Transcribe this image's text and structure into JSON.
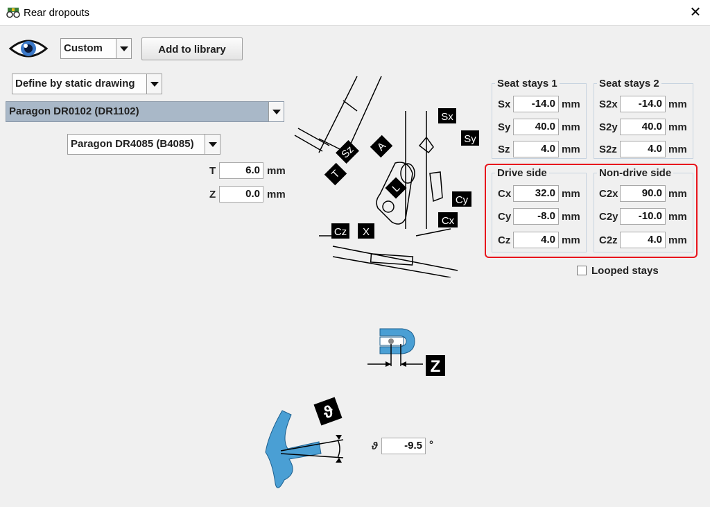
{
  "window": {
    "title": "Rear dropouts",
    "close_glyph": "✕"
  },
  "toolbar": {
    "preset_value": "Custom",
    "add_library_label": "Add to library",
    "define_mode_value": "Define by static drawing"
  },
  "dropout_select": {
    "value": "Paragon DR0102 (DR1102)"
  },
  "insert_select": {
    "value": "Paragon DR4085 (B4085)"
  },
  "thickness": {
    "T_label": "T",
    "T_value": "6.0",
    "Z_label": "Z",
    "Z_value": "0.0",
    "unit": "mm"
  },
  "seat_stays_1": {
    "title": "Seat stays 1",
    "rows": [
      {
        "label": "Sx",
        "value": "-14.0",
        "unit": "mm"
      },
      {
        "label": "Sy",
        "value": "40.0",
        "unit": "mm"
      },
      {
        "label": "Sz",
        "value": "4.0",
        "unit": "mm"
      }
    ]
  },
  "seat_stays_2": {
    "title": "Seat stays 2",
    "rows": [
      {
        "label": "S2x",
        "value": "-14.0",
        "unit": "mm"
      },
      {
        "label": "S2y",
        "value": "40.0",
        "unit": "mm"
      },
      {
        "label": "S2z",
        "value": "4.0",
        "unit": "mm"
      }
    ]
  },
  "drive_side": {
    "title": "Drive side",
    "rows": [
      {
        "label": "Cx",
        "value": "32.0",
        "unit": "mm"
      },
      {
        "label": "Cy",
        "value": "-8.0",
        "unit": "mm"
      },
      {
        "label": "Cz",
        "value": "4.0",
        "unit": "mm"
      }
    ]
  },
  "non_drive_side": {
    "title": "Non-drive side",
    "rows": [
      {
        "label": "C2x",
        "value": "90.0",
        "unit": "mm"
      },
      {
        "label": "C2y",
        "value": "-10.0",
        "unit": "mm"
      },
      {
        "label": "C2z",
        "value": "4.0",
        "unit": "mm"
      }
    ]
  },
  "looped_stays": {
    "label": "Looped stays",
    "checked": false
  },
  "angle": {
    "label": "ϑ",
    "value": "-9.5",
    "unit": "°"
  },
  "diagram_labels": {
    "sx": "Sx",
    "sy": "Sy",
    "sz": "Sz",
    "t": "T",
    "a": "A",
    "l": "L",
    "cy": "Cy",
    "cx": "Cx",
    "cz": "Cz",
    "x": "X",
    "z": "Z",
    "theta": "ϑ"
  },
  "colors": {
    "highlight": "#e8141c",
    "part_blue": "#4a9fd4",
    "group_border": "#c7d3e0"
  }
}
